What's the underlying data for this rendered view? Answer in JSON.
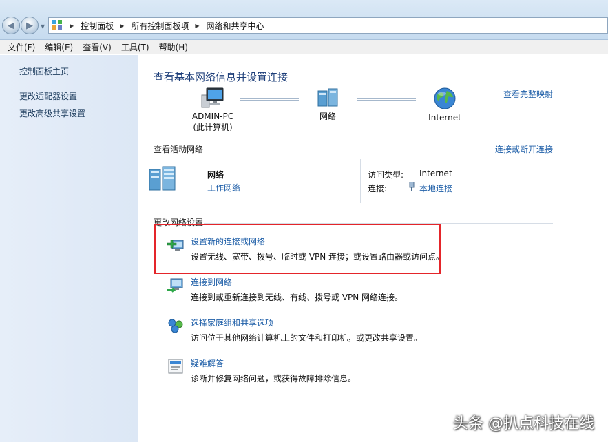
{
  "address_bar": {
    "back_glyph": "◀",
    "forward_glyph": "▶",
    "breadcrumbs": [
      "控制面板",
      "所有控制面板项",
      "网络和共享中心"
    ]
  },
  "menu": [
    "文件(F)",
    "编辑(E)",
    "查看(V)",
    "工具(T)",
    "帮助(H)"
  ],
  "sidebar": {
    "items": [
      {
        "label": "控制面板主页"
      },
      {
        "label": "更改适配器设置"
      },
      {
        "label": "更改高级共享设置"
      }
    ]
  },
  "main": {
    "title": "查看基本网络信息并设置连接",
    "full_map_link": "查看完整映射",
    "map": {
      "computer_name": "ADMIN-PC",
      "computer_sub": "(此计算机)",
      "network_label": "网络",
      "internet_label": "Internet"
    },
    "active_networks": {
      "heading": "查看活动网络",
      "connect_link": "连接或断开连接",
      "network_name": "网络",
      "network_type": "工作网络",
      "access_type_label": "访问类型:",
      "access_type_value": "Internet",
      "connection_label": "连接:",
      "connection_value": "本地连接"
    },
    "change_settings": {
      "heading": "更改网络设置",
      "tasks": [
        {
          "title": "设置新的连接或网络",
          "desc": "设置无线、宽带、拨号、临时或 VPN 连接；或设置路由器或访问点。"
        },
        {
          "title": "连接到网络",
          "desc": "连接到或重新连接到无线、有线、拨号或 VPN 网络连接。"
        },
        {
          "title": "选择家庭组和共享选项",
          "desc": "访问位于其他网络计算机上的文件和打印机，或更改共享设置。"
        },
        {
          "title": "疑难解答",
          "desc": "诊断并修复网络问题，或获得故障排除信息。"
        }
      ]
    }
  },
  "watermark": "头条 @扒点科技在线",
  "colors": {
    "link": "#1f5fa8",
    "title": "#1e3f7a",
    "highlight_box": "#e4252a",
    "sidebar_bg": "#dce7f5"
  }
}
